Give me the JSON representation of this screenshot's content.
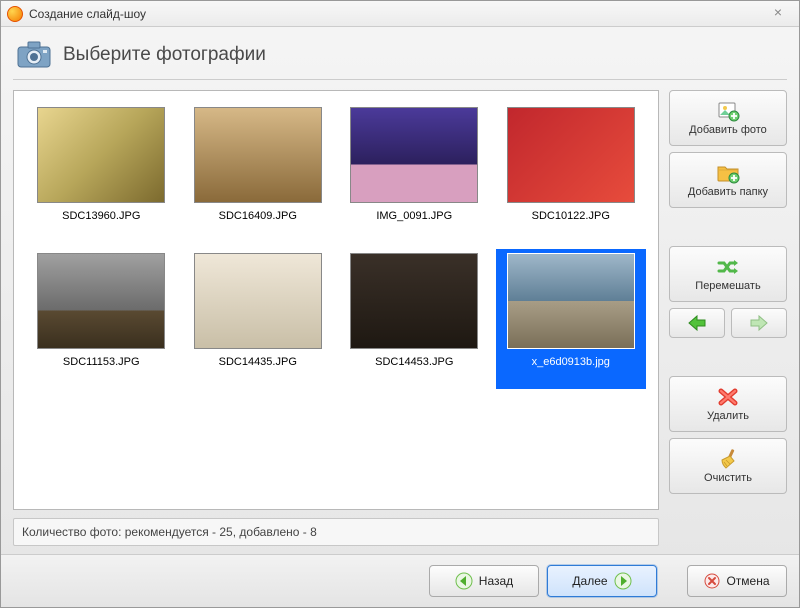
{
  "window": {
    "title": "Создание слайд-шоу"
  },
  "header": {
    "title": "Выберите фотографии"
  },
  "gallery": {
    "items": [
      {
        "filename": "SDC13960.JPG",
        "selected": false
      },
      {
        "filename": "SDC16409.JPG",
        "selected": false
      },
      {
        "filename": "IMG_0091.JPG",
        "selected": false
      },
      {
        "filename": "SDC10122.JPG",
        "selected": false
      },
      {
        "filename": "SDC11153.JPG",
        "selected": false
      },
      {
        "filename": "SDC14435.JPG",
        "selected": false
      },
      {
        "filename": "SDC14453.JPG",
        "selected": false
      },
      {
        "filename": "x_e6d0913b.jpg",
        "selected": true
      }
    ]
  },
  "sidebar": {
    "add_photo": "Добавить фото",
    "add_folder": "Добавить папку",
    "shuffle": "Перемешать",
    "delete": "Удалить",
    "clear": "Очистить"
  },
  "status": {
    "text": "Количество фото: рекомендуется - 25, добавлено - 8"
  },
  "footer": {
    "back": "Назад",
    "next": "Далее",
    "cancel": "Отмена"
  }
}
